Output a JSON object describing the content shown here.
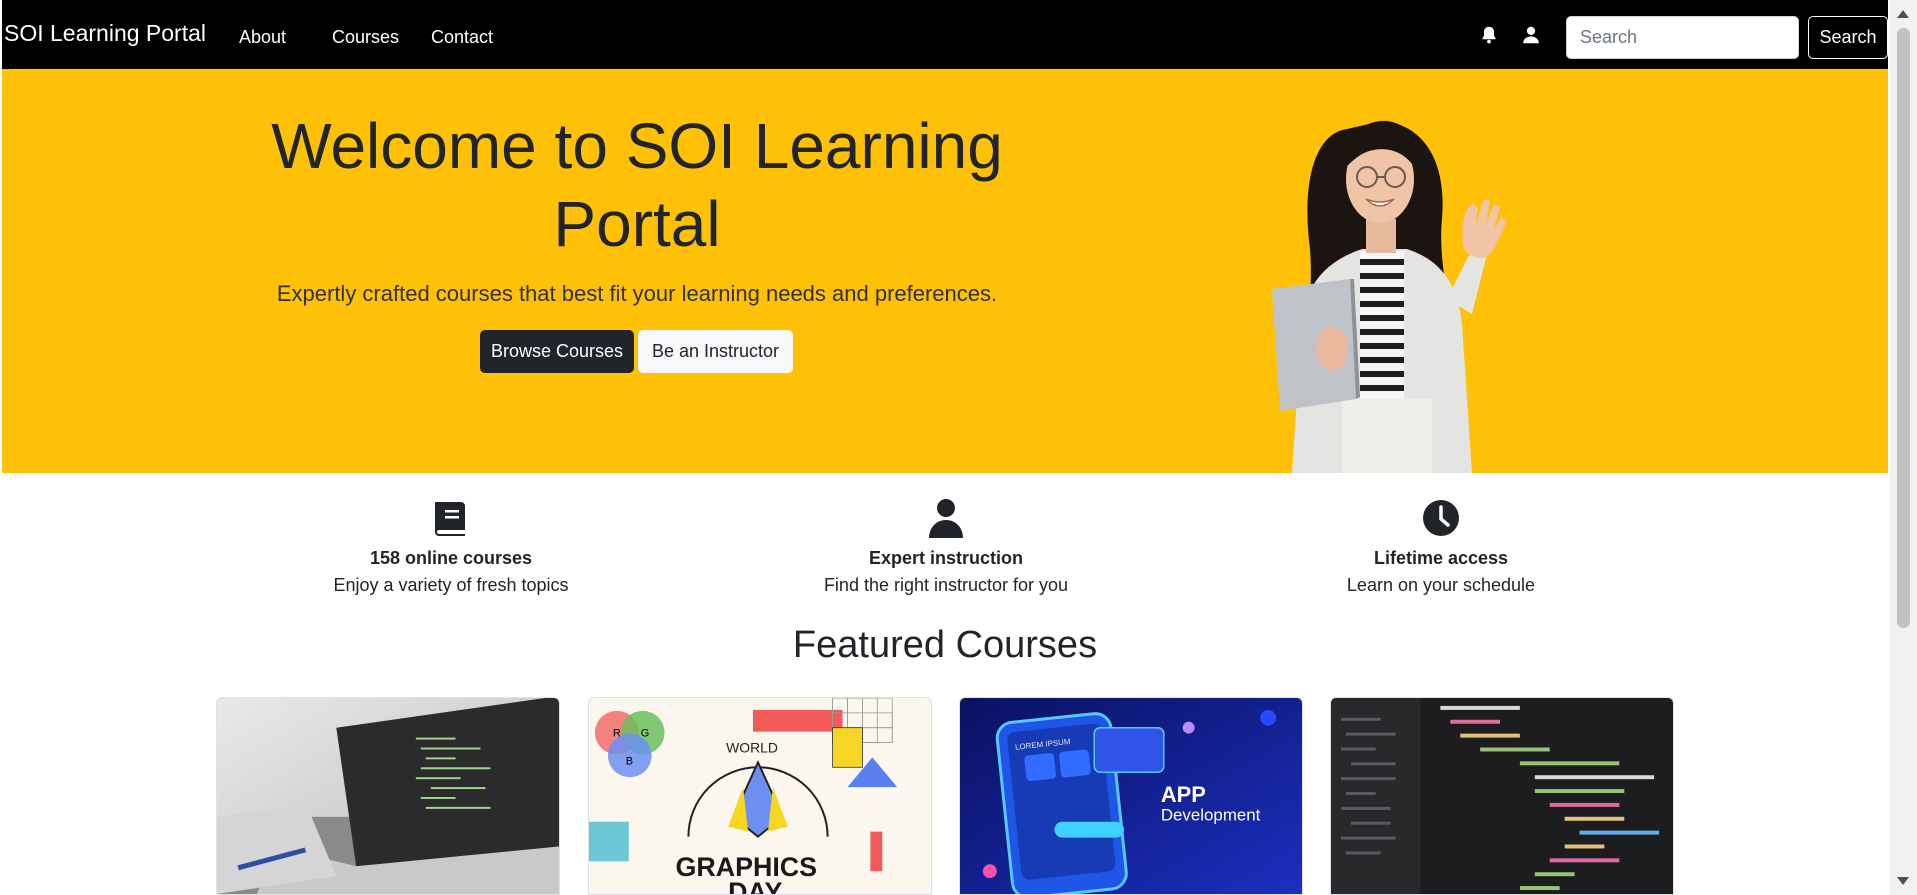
{
  "navbar": {
    "brand": "SOI Learning Portal",
    "links": [
      "About",
      "Courses",
      "Contact"
    ],
    "icons": [
      "bell-icon",
      "user-icon"
    ],
    "search": {
      "placeholder": "Search",
      "button_label": "Search"
    }
  },
  "hero": {
    "title": "Welcome to SOI Learning Portal",
    "subtitle": "Expertly crafted courses that best fit your learning needs and preferences.",
    "primary_button": "Browse Courses",
    "secondary_button": "Be an Instructor",
    "background_color": "#ffc107"
  },
  "features": [
    {
      "icon": "book-icon",
      "title": "158 online courses",
      "description": "Enjoy a variety of fresh topics"
    },
    {
      "icon": "user-icon",
      "title": "Expert instruction",
      "description": "Find the right instructor for you"
    },
    {
      "icon": "clock-icon",
      "title": "Lifetime access",
      "description": "Learn on your schedule"
    }
  ],
  "featured": {
    "title": "Featured Courses",
    "cards": [
      {
        "image": "laptop-code-image"
      },
      {
        "image": "graphics-day-image",
        "text_top": "WORLD",
        "text_main": "GRAPHICS",
        "text_sub": "DAY",
        "venn_labels": [
          "R",
          "G",
          "B"
        ]
      },
      {
        "image": "app-development-image",
        "text_main": "APP",
        "text_sub": "Development",
        "screen_label": "LOREM IPSUM"
      },
      {
        "image": "code-editor-image"
      }
    ]
  }
}
